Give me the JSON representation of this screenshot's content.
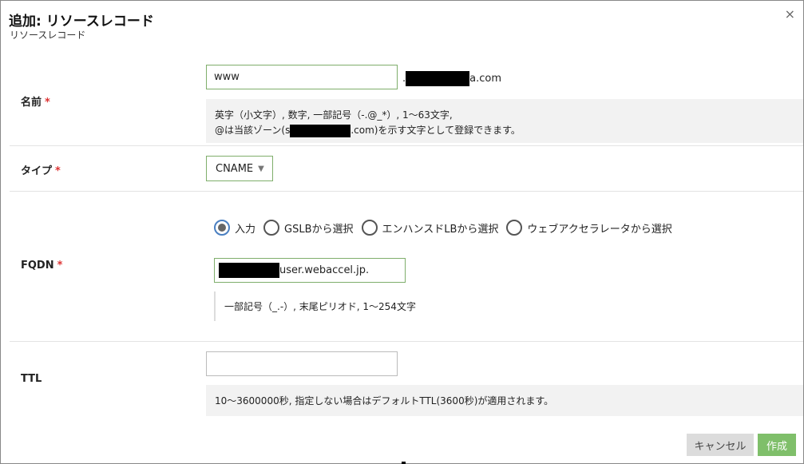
{
  "dialog": {
    "title": "追加: リソースレコード",
    "subtitle": "リソースレコード",
    "close_label": "×"
  },
  "name_field": {
    "label": "名前",
    "required_mark": "*",
    "value": "www",
    "zone_prefix": ".",
    "zone_suffix": "a.com",
    "hint_line1": "英字（小文字）, 数字, 一部記号（-.@_*）, 1～63文字,",
    "hint_line2_pre": "@は当該ゾーン(",
    "hint_line2_partial": "s",
    "hint_line2_post": ".com)を示す文字として登録できます。"
  },
  "type_field": {
    "label": "タイプ",
    "required_mark": "*",
    "selected": "CNAME",
    "caret": "▼"
  },
  "fqdn_field": {
    "label": "FQDN",
    "required_mark": "*",
    "options": [
      {
        "label": "入力",
        "selected": true
      },
      {
        "label": "GSLBから選択",
        "selected": false
      },
      {
        "label": "エンハンスドLBから選択",
        "selected": false
      },
      {
        "label": "ウェブアクセラレータから選択",
        "selected": false
      }
    ],
    "value_suffix": "user.webaccel.jp.",
    "hint": "一部記号（_.-）, 末尾ピリオド, 1～254文字"
  },
  "ttl_field": {
    "label": "TTL",
    "value": "",
    "hint": "10～3600000秒, 指定しない場合はデフォルトTTL(3600秒)が適用されます。"
  },
  "footer": {
    "cancel_label": "キャンセル",
    "create_label": "作成"
  },
  "colors": {
    "accent_green": "#7fbf6a",
    "required_red": "#d33333",
    "radio_selected_border": "#4a7fc1"
  }
}
